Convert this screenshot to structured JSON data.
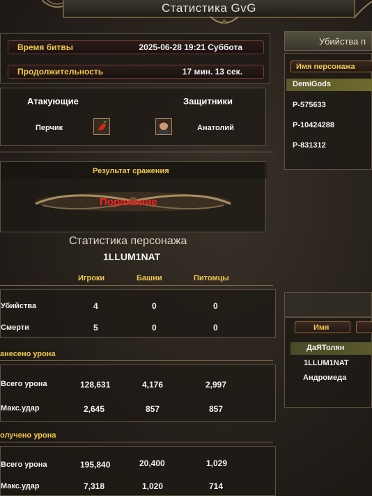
{
  "window": {
    "title": "Статистика GvG"
  },
  "battle": {
    "time_label": "Время битвы",
    "time_value": "2025-06-28 19:21 Суббота",
    "duration_label": "Продолжительность",
    "duration_value": "17 мин. 13 сек."
  },
  "sides": {
    "attackers_label": "Атакующие",
    "defenders_label": "Защитники",
    "attacker_name": "Перчик",
    "defender_name": "Анатолий"
  },
  "result": {
    "label": "Результат сражения",
    "value": "Поражение"
  },
  "character": {
    "section_title": "Статистика персонажа",
    "name": "1LLUM1NAT",
    "columns": [
      "Игроки",
      "Башни",
      "Питомцы"
    ],
    "kills_label": "Убийства",
    "kills": [
      "4",
      "0",
      "0"
    ],
    "deaths_label": "Смерти",
    "deaths": [
      "5",
      "0",
      "0"
    ],
    "dealt_title": "анесено урона",
    "dealt_total_label": "Всего урона",
    "dealt_total": [
      "128,631",
      "4,176",
      "2,997"
    ],
    "dealt_max_label": "Макс.удар",
    "dealt_max": [
      "2,645",
      "857",
      "857"
    ],
    "received_title": "олучено урона",
    "received_total_label": "Всего урона",
    "received_total": [
      "195,840",
      "20,400",
      "1,029"
    ],
    "received_max_label": "Макс.удар",
    "received_max": [
      "7,318",
      "1,020",
      "714"
    ]
  },
  "right_top": {
    "title": "Убийства п",
    "column": "Имя персонажа",
    "items": [
      "DemiGods",
      "P-575633",
      "P-10424288",
      "P-831312"
    ]
  },
  "right_bottom": {
    "column": "Имя",
    "items": [
      "ДаЯТолян",
      "1LLUM1NAT",
      "Андромеда"
    ]
  }
}
